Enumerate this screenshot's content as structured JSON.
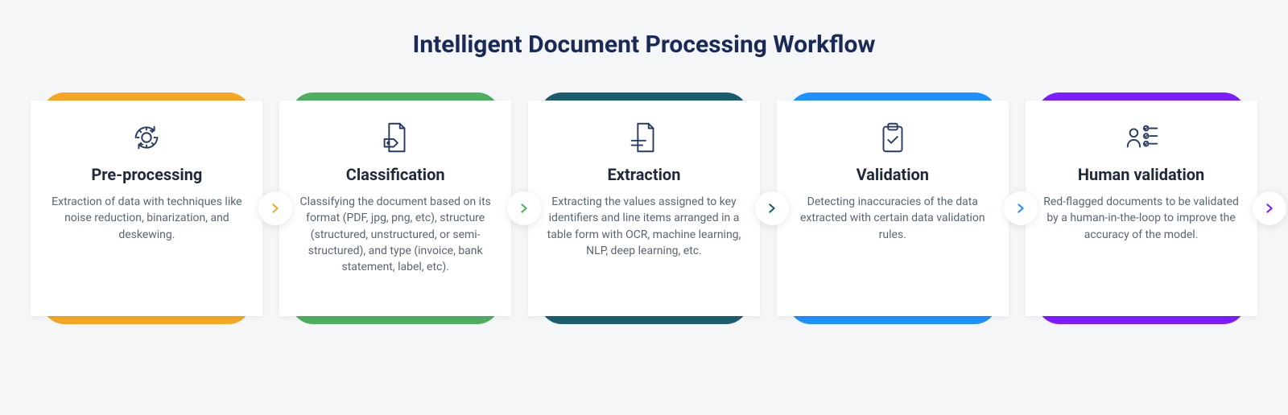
{
  "title": "Intelligent Document Processing Workflow",
  "steps": [
    {
      "name": "Pre-processing",
      "desc": "Extraction of data with techniques like noise reduction, binarization, and deskewing.",
      "icon": "gear-cycle-icon",
      "color": "#f5a623"
    },
    {
      "name": "Classification",
      "desc": "Classifying the document based on its format (PDF, jpg, png, etc), structure (structured, unstructured, or semi-structured), and type (invoice, bank statement, label, etc).",
      "icon": "document-tag-icon",
      "color": "#4fae60"
    },
    {
      "name": "Extraction",
      "desc": "Extracting the values assigned to key identifiers and line items arranged in a table form with OCR, machine learning, NLP, deep learning, etc.",
      "icon": "document-lines-icon",
      "color": "#1b5d6e"
    },
    {
      "name": "Validation",
      "desc": "Detecting inaccuracies of the data extracted with certain data validation rules.",
      "icon": "clipboard-check-icon",
      "color": "#1e90ff"
    },
    {
      "name": "Human validation",
      "desc": "Red-flagged documents to be validated by a human-in-the-loop to improve the accuracy of the model.",
      "icon": "human-checklist-icon",
      "color": "#7c1cff"
    }
  ]
}
